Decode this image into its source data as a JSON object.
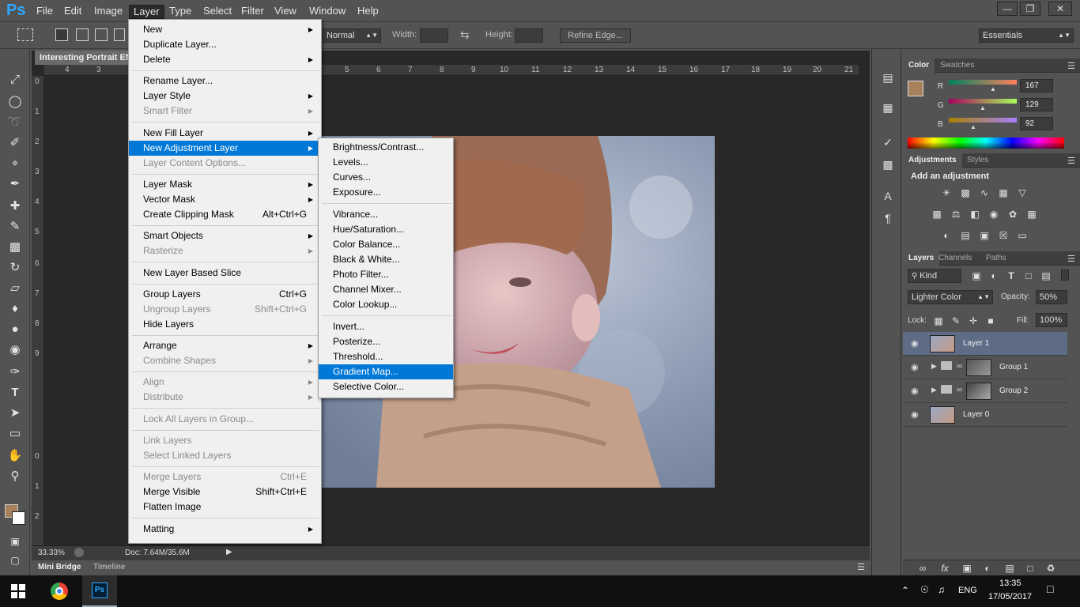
{
  "app": {
    "logo": "Ps"
  },
  "menubar": {
    "items": [
      "File",
      "Edit",
      "Image",
      "Layer",
      "Type",
      "Select",
      "Filter",
      "View",
      "Window",
      "Help"
    ],
    "active": "Layer",
    "window_buttons": [
      "minimize-icon",
      "restore-icon",
      "close-icon"
    ]
  },
  "options": {
    "mode": "Normal",
    "width_label": "Width:",
    "height_label": "Height:",
    "refine_edge": "Refine Edge...",
    "workspace": "Essentials"
  },
  "document": {
    "tab_title": "Interesting Portrait Ef",
    "ruler_h": [
      "4",
      "3",
      "5",
      "6",
      "7",
      "8",
      "9",
      "10",
      "11",
      "12",
      "13",
      "14",
      "15",
      "16",
      "17",
      "18",
      "19",
      "20",
      "21"
    ],
    "ruler_v": [
      "0",
      "1",
      "2",
      "3",
      "4",
      "5",
      "6",
      "7",
      "8",
      "9",
      "0",
      "1",
      "2"
    ],
    "zoom": "33.33%",
    "doc_info": "Doc: 7.64M/35.6M"
  },
  "bottom_tabs": [
    "Mini Bridge",
    "Timeline"
  ],
  "layer_menu": [
    {
      "label": "New",
      "arrow": true
    },
    {
      "label": "Duplicate Layer..."
    },
    {
      "label": "Delete",
      "arrow": true
    },
    {
      "sep": true
    },
    {
      "label": "Rename Layer..."
    },
    {
      "label": "Layer Style",
      "arrow": true
    },
    {
      "label": "Smart Filter",
      "arrow": true,
      "disabled": true
    },
    {
      "sep": true
    },
    {
      "label": "New Fill Layer",
      "arrow": true
    },
    {
      "label": "New Adjustment Layer",
      "arrow": true,
      "highlight": true
    },
    {
      "label": "Layer Content Options...",
      "disabled": true
    },
    {
      "sep": true
    },
    {
      "label": "Layer Mask",
      "arrow": true
    },
    {
      "label": "Vector Mask",
      "arrow": true
    },
    {
      "label": "Create Clipping Mask",
      "shortcut": "Alt+Ctrl+G"
    },
    {
      "sep": true
    },
    {
      "label": "Smart Objects",
      "arrow": true
    },
    {
      "label": "Rasterize",
      "arrow": true,
      "disabled": true
    },
    {
      "sep": true
    },
    {
      "label": "New Layer Based Slice"
    },
    {
      "sep": true
    },
    {
      "label": "Group Layers",
      "shortcut": "Ctrl+G"
    },
    {
      "label": "Ungroup Layers",
      "shortcut": "Shift+Ctrl+G",
      "disabled": true
    },
    {
      "label": "Hide Layers"
    },
    {
      "sep": true
    },
    {
      "label": "Arrange",
      "arrow": true
    },
    {
      "label": "Combine Shapes",
      "arrow": true,
      "disabled": true
    },
    {
      "sep": true
    },
    {
      "label": "Align",
      "arrow": true,
      "disabled": true
    },
    {
      "label": "Distribute",
      "arrow": true,
      "disabled": true
    },
    {
      "sep": true
    },
    {
      "label": "Lock All Layers in Group...",
      "disabled": true
    },
    {
      "sep": true
    },
    {
      "label": "Link Layers",
      "disabled": true
    },
    {
      "label": "Select Linked Layers",
      "disabled": true
    },
    {
      "sep": true
    },
    {
      "label": "Merge Layers",
      "shortcut": "Ctrl+E",
      "disabled": true
    },
    {
      "label": "Merge Visible",
      "shortcut": "Shift+Ctrl+E"
    },
    {
      "label": "Flatten Image"
    },
    {
      "sep": true
    },
    {
      "label": "Matting",
      "arrow": true
    }
  ],
  "adjust_menu": [
    {
      "label": "Brightness/Contrast..."
    },
    {
      "label": "Levels..."
    },
    {
      "label": "Curves..."
    },
    {
      "label": "Exposure..."
    },
    {
      "sep": true
    },
    {
      "label": "Vibrance..."
    },
    {
      "label": "Hue/Saturation..."
    },
    {
      "label": "Color Balance..."
    },
    {
      "label": "Black & White..."
    },
    {
      "label": "Photo Filter..."
    },
    {
      "label": "Channel Mixer..."
    },
    {
      "label": "Color Lookup..."
    },
    {
      "sep": true
    },
    {
      "label": "Invert..."
    },
    {
      "label": "Posterize..."
    },
    {
      "label": "Threshold..."
    },
    {
      "label": "Gradient Map...",
      "highlight": true
    },
    {
      "label": "Selective Color..."
    }
  ],
  "color_panel": {
    "tabs": [
      "Color",
      "Swatches"
    ],
    "channels": [
      {
        "label": "R",
        "value": "167"
      },
      {
        "label": "G",
        "value": "129"
      },
      {
        "label": "B",
        "value": "92"
      }
    ],
    "foreground": "#a7815c",
    "background": "#ffffff"
  },
  "adjustments_panel": {
    "tabs": [
      "Adjustments",
      "Styles"
    ],
    "heading": "Add an adjustment"
  },
  "layers_panel": {
    "tabs": [
      "Layers",
      "Channels",
      "Paths"
    ],
    "kind": "Kind",
    "blend_mode": "Lighter Color",
    "opacity_label": "Opacity:",
    "opacity": "50%",
    "lock_label": "Lock:",
    "fill_label": "Fill:",
    "fill": "100%",
    "layers": [
      {
        "name": "Layer 1",
        "selected": true,
        "group": false
      },
      {
        "name": "Group 1",
        "selected": false,
        "group": true
      },
      {
        "name": "Group 2",
        "selected": false,
        "group": true
      },
      {
        "name": "Layer 0",
        "selected": false,
        "group": false
      }
    ]
  },
  "taskbar": {
    "lang": "ENG",
    "time": "13:35",
    "date": "17/05/2017"
  }
}
